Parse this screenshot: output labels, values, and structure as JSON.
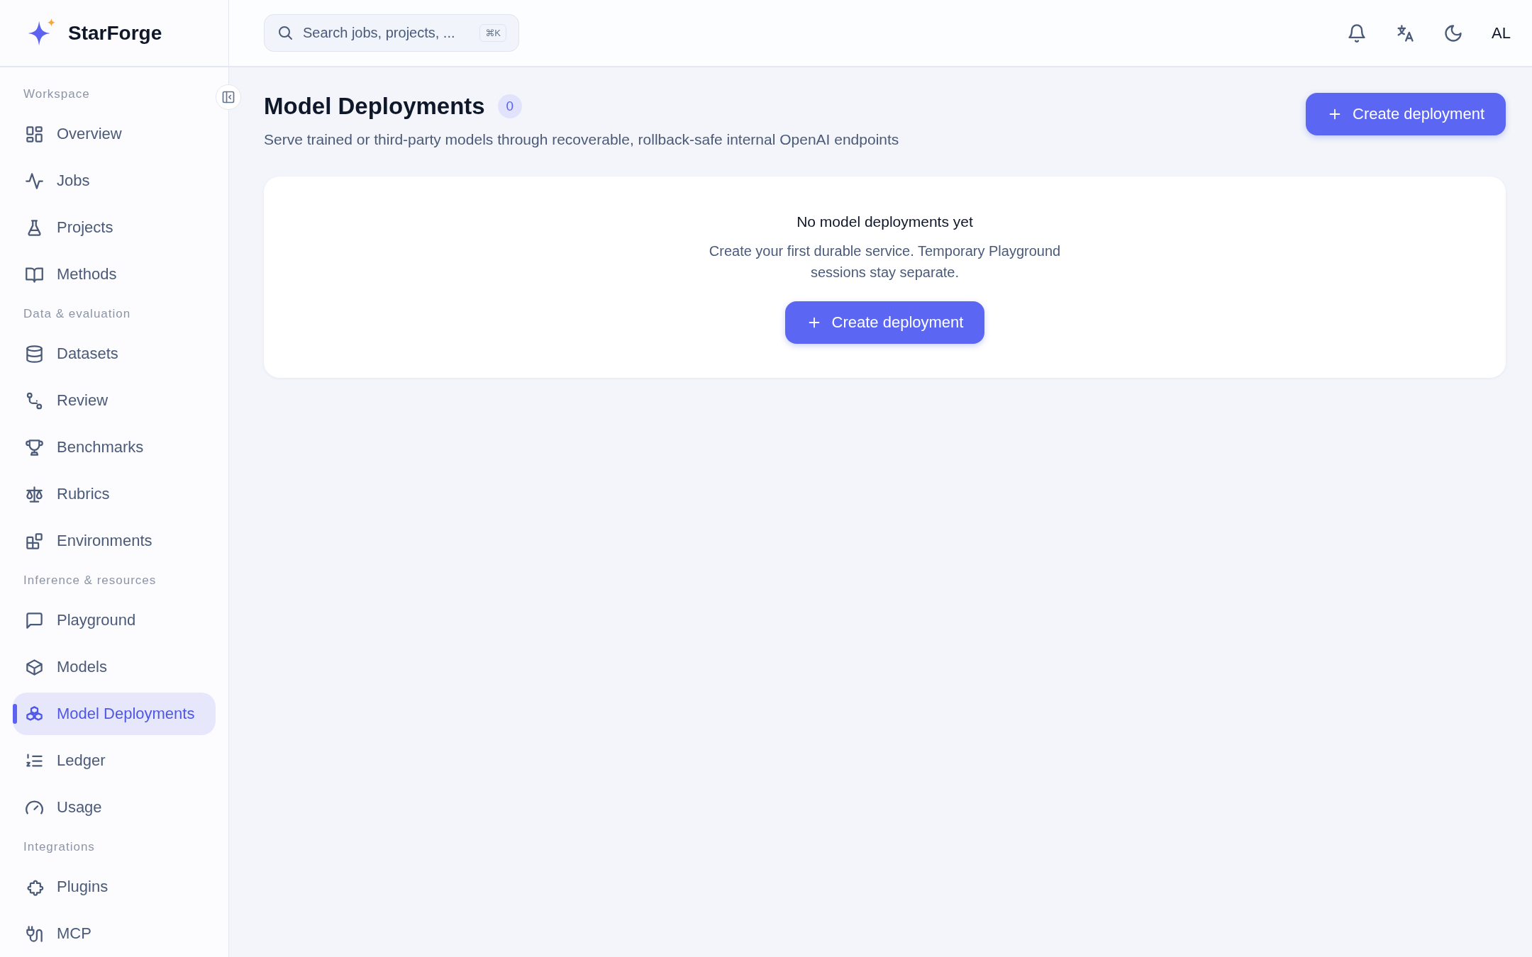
{
  "brand": {
    "name": "StarForge"
  },
  "sidebar": {
    "sections": [
      {
        "title": "Workspace",
        "items": [
          {
            "label": "Overview",
            "kind": "grid",
            "selected": false
          },
          {
            "label": "Jobs",
            "kind": "pulse",
            "selected": false
          },
          {
            "label": "Projects",
            "kind": "flask",
            "selected": false
          },
          {
            "label": "Methods",
            "kind": "book",
            "selected": false
          }
        ]
      },
      {
        "title": "Data & evaluation",
        "items": [
          {
            "label": "Datasets",
            "kind": "database",
            "selected": false
          },
          {
            "label": "Review",
            "kind": "branch",
            "selected": false
          },
          {
            "label": "Benchmarks",
            "kind": "trophy",
            "selected": false
          },
          {
            "label": "Rubrics",
            "kind": "scale",
            "selected": false
          },
          {
            "label": "Environments",
            "kind": "blocks",
            "selected": false
          }
        ]
      },
      {
        "title": "Inference & resources",
        "items": [
          {
            "label": "Playground",
            "kind": "chat",
            "selected": false
          },
          {
            "label": "Models",
            "kind": "box",
            "selected": false
          },
          {
            "label": "Model Deployments",
            "kind": "boxes",
            "selected": true
          },
          {
            "label": "Ledger",
            "kind": "list",
            "selected": false
          },
          {
            "label": "Usage",
            "kind": "gauge",
            "selected": false
          }
        ]
      },
      {
        "title": "Integrations",
        "items": [
          {
            "label": "Plugins",
            "kind": "puzzle",
            "selected": false
          },
          {
            "label": "MCP",
            "kind": "plug",
            "selected": false
          }
        ]
      }
    ]
  },
  "header": {
    "search": {
      "placeholder": "Search jobs, projects, ...",
      "shortcut": "⌘K"
    },
    "avatar": "AL"
  },
  "page": {
    "title": "Model Deployments",
    "count": "0",
    "subtitle": "Serve trained or third-party models through recoverable, rollback-safe internal OpenAI endpoints",
    "action": "Create deployment"
  },
  "empty_state": {
    "heading": "No model deployments yet",
    "text": "Create your first durable service. Temporary Playground sessions stay separate.",
    "action": "Create deployment"
  }
}
